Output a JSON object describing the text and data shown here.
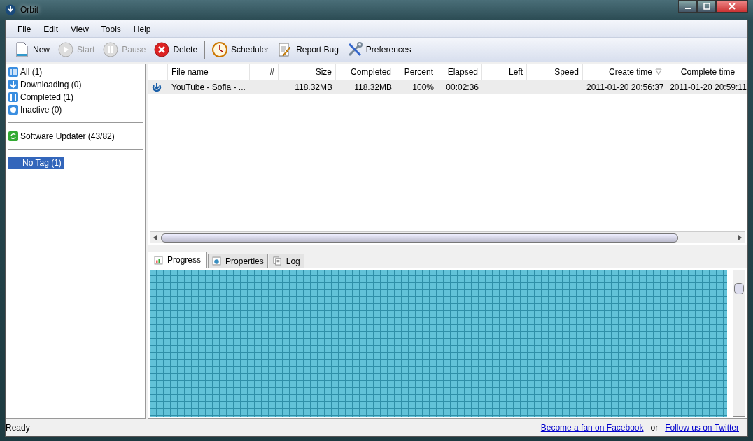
{
  "window": {
    "title": "Orbit"
  },
  "menu": [
    "File",
    "Edit",
    "View",
    "Tools",
    "Help"
  ],
  "toolbar": [
    {
      "kind": "new",
      "label": "New",
      "disabled": false
    },
    {
      "kind": "start",
      "label": "Start",
      "disabled": true
    },
    {
      "kind": "pause",
      "label": "Pause",
      "disabled": true
    },
    {
      "kind": "delete",
      "label": "Delete",
      "disabled": false
    },
    {
      "kind": "scheduler",
      "label": "Scheduler",
      "disabled": false
    },
    {
      "kind": "report",
      "label": "Report Bug",
      "disabled": false
    },
    {
      "kind": "preferences",
      "label": "Preferences",
      "disabled": false
    }
  ],
  "sidebar": {
    "groups": [
      {
        "items": [
          {
            "kind": "all",
            "label": "All (1)",
            "selected": false
          },
          {
            "kind": "downloading",
            "label": "Downloading (0)",
            "selected": false
          },
          {
            "kind": "completed",
            "label": "Completed (1)",
            "selected": false
          },
          {
            "kind": "inactive",
            "label": "Inactive (0)",
            "selected": false
          }
        ]
      },
      {
        "items": [
          {
            "kind": "updater",
            "label": "Software Updater (43/82)",
            "selected": false
          }
        ]
      },
      {
        "items": [
          {
            "kind": "tag",
            "label": "No Tag (1)",
            "selected": true
          }
        ]
      }
    ]
  },
  "table": {
    "columns": [
      {
        "sorted": false
      },
      {
        "label": "File name",
        "sorted": false
      },
      {
        "label": "#",
        "sorted": false
      },
      {
        "label": "Size",
        "sorted": false
      },
      {
        "label": "Completed",
        "sorted": false
      },
      {
        "label": "Percent",
        "sorted": false
      },
      {
        "label": "Elapsed",
        "sorted": false
      },
      {
        "label": "Left",
        "sorted": false
      },
      {
        "label": "Speed",
        "sorted": false
      },
      {
        "label": "Create time",
        "sorted": true
      },
      {
        "label": "Complete time",
        "sorted": false
      }
    ],
    "rows": [
      {
        "selected": true,
        "cells": [
          "",
          "YouTube - Sofia - ...",
          "",
          "118.32MB",
          "118.32MB",
          "100%",
          "00:02:36",
          "",
          "",
          "2011-01-20 20:56:37",
          "2011-01-20 20:59:11"
        ]
      }
    ]
  },
  "tabs": [
    {
      "kind": "progress",
      "label": "Progress",
      "selected": true
    },
    {
      "kind": "properties",
      "label": "Properties",
      "selected": false
    },
    {
      "kind": "log",
      "label": "Log",
      "selected": false
    }
  ],
  "status_bar": {
    "text": "Ready",
    "links": [
      "Become a fan on Facebook",
      "Follow us on Twitter"
    ],
    "separator": "or"
  }
}
